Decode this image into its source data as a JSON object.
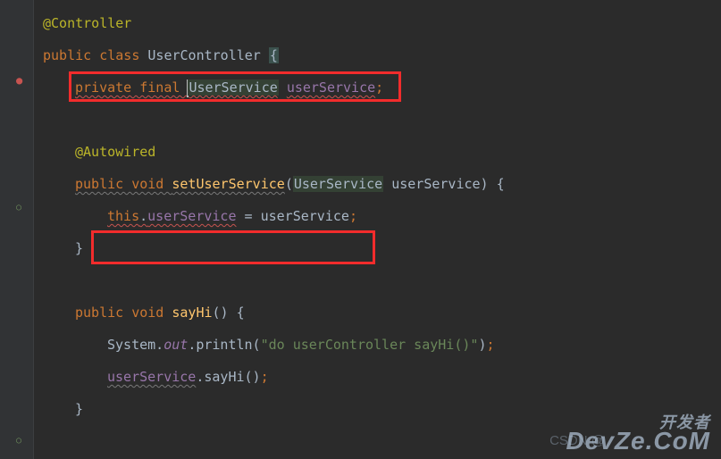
{
  "code": {
    "line1": "@Controller",
    "line2_kw1": "public class ",
    "line2_name": "UserController ",
    "line2_brace": "{",
    "line3_kw": "private final ",
    "line3_type": "UserService",
    "line3_space": " ",
    "line3_field": "userService",
    "line3_semi": ";",
    "line5": "@Autowired",
    "line6_kw": "public void ",
    "line6_method": "setUserService",
    "line6_p1": "(",
    "line6_ptype": "UserService",
    "line6_pname": " userService) ",
    "line6_brace": "{",
    "line7_this": "this",
    "line7_dot": ".",
    "line7_field": "userService",
    "line7_eq": " = userService",
    "line7_semi": ";",
    "line8": "}",
    "line10_kw": "public void ",
    "line10_method": "sayHi",
    "line10_rest": "() {",
    "line11_sys": "System.",
    "line11_out": "out",
    "line11_print": ".println(",
    "line11_str": "\"do userController sayHi()\"",
    "line11_end": ")",
    "line11_semi": ";",
    "line12_us": "userService",
    "line12_call": ".sayHi()",
    "line12_semi": ";",
    "line13": "}"
  },
  "watermark": {
    "line1": "开发者",
    "line2": "DevZe.CoM",
    "csdn": "CSDN @"
  }
}
